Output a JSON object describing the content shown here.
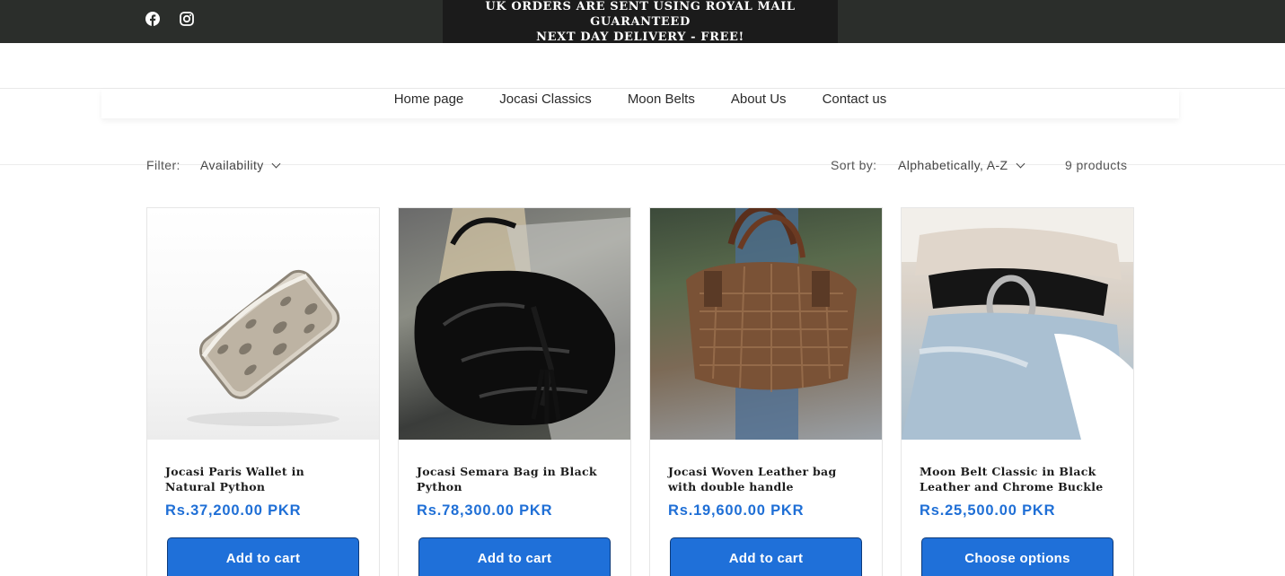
{
  "announcement": {
    "line1": "UK ORDERS ARE SENT USING ROYAL MAIL GUARANTEED",
    "line2": "NEXT DAY DELIVERY - FREE!"
  },
  "social": [
    "facebook-icon",
    "instagram-icon"
  ],
  "nav": {
    "items": [
      {
        "label": "Home page"
      },
      {
        "label": "Jocasi Classics"
      },
      {
        "label": "Moon Belts"
      },
      {
        "label": "About Us"
      },
      {
        "label": "Contact us"
      }
    ]
  },
  "filters": {
    "filter_label": "Filter:",
    "availability": "Availability",
    "sort_label": "Sort by:",
    "sort_value": "Alphabetically, A-Z",
    "count": "9 products"
  },
  "products": [
    {
      "title": "Jocasi Paris Wallet in Natural Python",
      "price": "Rs.37,200.00 PKR",
      "button": "Add to cart"
    },
    {
      "title": "Jocasi Semara Bag in Black Python",
      "price": "Rs.78,300.00 PKR",
      "button": "Add to cart"
    },
    {
      "title": "Jocasi Woven Leather bag with double handle",
      "price": "Rs.19,600.00 PKR",
      "button": "Add to cart"
    },
    {
      "title": "Moon Belt Classic in Black Leather and Chrome Buckle",
      "price": "Rs.25,500.00 PKR",
      "button": "Choose options"
    }
  ],
  "colors": {
    "topbar": "#2b2e2b",
    "announcement_bg": "#1b1b1b",
    "price": "#1f6fd6",
    "button": "#1f70d9"
  }
}
